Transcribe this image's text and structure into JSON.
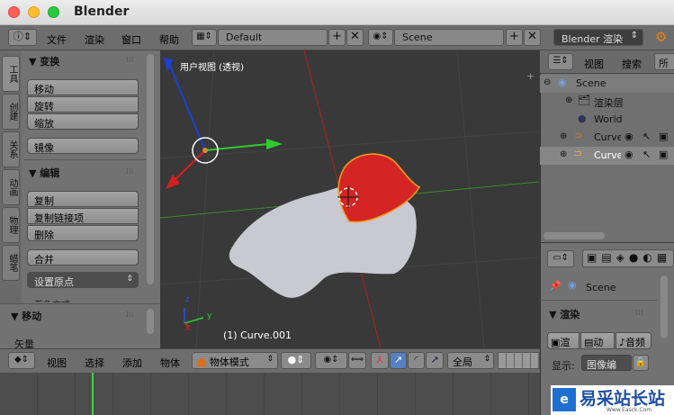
{
  "window": {
    "title": "Blender"
  },
  "info_bar": {
    "menus": [
      "文件",
      "渲染",
      "窗口",
      "帮助"
    ],
    "screen_layout": "Default",
    "scene": "Scene",
    "render_engine": "Blender 渲染"
  },
  "tool_shelf": {
    "tabs": [
      "工具",
      "创建",
      "关系",
      "动画",
      "物理",
      "蜡笔"
    ],
    "transform_header": "▼ 变换",
    "transform_buttons": [
      "移动",
      "旋转",
      "缩放"
    ],
    "mirror_button": "镜像",
    "edit_header": "▼ 编辑",
    "edit_buttons": [
      "复制",
      "复制链接项",
      "删除"
    ],
    "join_button": "合并",
    "origin_dropdown": "设置原点",
    "shading_label": "着色方式:",
    "operator_header": "▼ 移动",
    "operator_field": "矢量"
  },
  "viewport": {
    "view_label": "用户视图 (透视)",
    "object_label": "(1) Curve.001",
    "axis_x": "x",
    "axis_y": "y",
    "axis_z": "z"
  },
  "view3d_header": {
    "menus": [
      "视图",
      "选择",
      "添加",
      "物体"
    ],
    "mode": "物体模式",
    "layer_scope": "全局"
  },
  "outliner": {
    "menus": [
      "视图",
      "搜索",
      "所"
    ],
    "items": [
      {
        "label": "Scene"
      },
      {
        "label": "渲染层"
      },
      {
        "label": "World"
      },
      {
        "label": "Curve"
      },
      {
        "label": "Curve"
      }
    ]
  },
  "properties": {
    "scene_label": "Scene",
    "render_header": "▼ 渲染",
    "render_buttons": [
      "渲",
      "动",
      "音频"
    ],
    "display_label": "显示:",
    "display_value": "图像编"
  },
  "watermark": {
    "text": "易采站长站",
    "url": "Www.Easck.Com"
  },
  "colors": {
    "selected_curve": "#d42424",
    "curve": "#c8c8d0",
    "bg": "#393939"
  }
}
